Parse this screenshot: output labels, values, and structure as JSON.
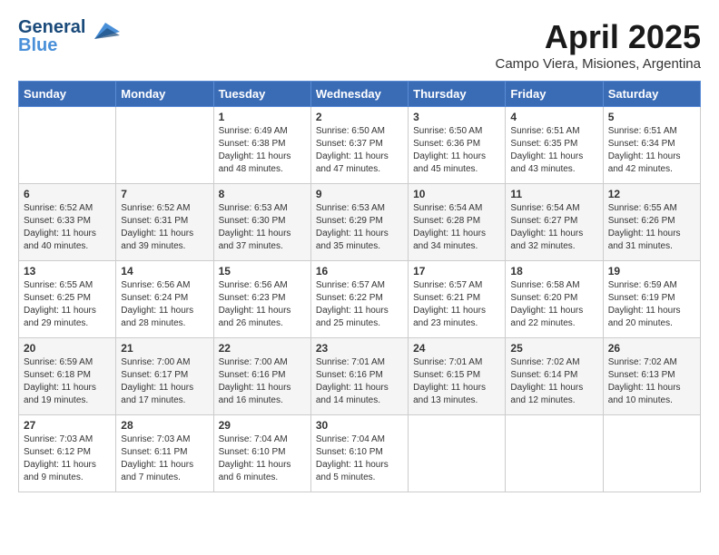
{
  "header": {
    "logo_line1": "General",
    "logo_line2": "Blue",
    "month_year": "April 2025",
    "location": "Campo Viera, Misiones, Argentina"
  },
  "weekdays": [
    "Sunday",
    "Monday",
    "Tuesday",
    "Wednesday",
    "Thursday",
    "Friday",
    "Saturday"
  ],
  "weeks": [
    [
      {
        "day": "",
        "info": ""
      },
      {
        "day": "",
        "info": ""
      },
      {
        "day": "1",
        "info": "Sunrise: 6:49 AM\nSunset: 6:38 PM\nDaylight: 11 hours and 48 minutes."
      },
      {
        "day": "2",
        "info": "Sunrise: 6:50 AM\nSunset: 6:37 PM\nDaylight: 11 hours and 47 minutes."
      },
      {
        "day": "3",
        "info": "Sunrise: 6:50 AM\nSunset: 6:36 PM\nDaylight: 11 hours and 45 minutes."
      },
      {
        "day": "4",
        "info": "Sunrise: 6:51 AM\nSunset: 6:35 PM\nDaylight: 11 hours and 43 minutes."
      },
      {
        "day": "5",
        "info": "Sunrise: 6:51 AM\nSunset: 6:34 PM\nDaylight: 11 hours and 42 minutes."
      }
    ],
    [
      {
        "day": "6",
        "info": "Sunrise: 6:52 AM\nSunset: 6:33 PM\nDaylight: 11 hours and 40 minutes."
      },
      {
        "day": "7",
        "info": "Sunrise: 6:52 AM\nSunset: 6:31 PM\nDaylight: 11 hours and 39 minutes."
      },
      {
        "day": "8",
        "info": "Sunrise: 6:53 AM\nSunset: 6:30 PM\nDaylight: 11 hours and 37 minutes."
      },
      {
        "day": "9",
        "info": "Sunrise: 6:53 AM\nSunset: 6:29 PM\nDaylight: 11 hours and 35 minutes."
      },
      {
        "day": "10",
        "info": "Sunrise: 6:54 AM\nSunset: 6:28 PM\nDaylight: 11 hours and 34 minutes."
      },
      {
        "day": "11",
        "info": "Sunrise: 6:54 AM\nSunset: 6:27 PM\nDaylight: 11 hours and 32 minutes."
      },
      {
        "day": "12",
        "info": "Sunrise: 6:55 AM\nSunset: 6:26 PM\nDaylight: 11 hours and 31 minutes."
      }
    ],
    [
      {
        "day": "13",
        "info": "Sunrise: 6:55 AM\nSunset: 6:25 PM\nDaylight: 11 hours and 29 minutes."
      },
      {
        "day": "14",
        "info": "Sunrise: 6:56 AM\nSunset: 6:24 PM\nDaylight: 11 hours and 28 minutes."
      },
      {
        "day": "15",
        "info": "Sunrise: 6:56 AM\nSunset: 6:23 PM\nDaylight: 11 hours and 26 minutes."
      },
      {
        "day": "16",
        "info": "Sunrise: 6:57 AM\nSunset: 6:22 PM\nDaylight: 11 hours and 25 minutes."
      },
      {
        "day": "17",
        "info": "Sunrise: 6:57 AM\nSunset: 6:21 PM\nDaylight: 11 hours and 23 minutes."
      },
      {
        "day": "18",
        "info": "Sunrise: 6:58 AM\nSunset: 6:20 PM\nDaylight: 11 hours and 22 minutes."
      },
      {
        "day": "19",
        "info": "Sunrise: 6:59 AM\nSunset: 6:19 PM\nDaylight: 11 hours and 20 minutes."
      }
    ],
    [
      {
        "day": "20",
        "info": "Sunrise: 6:59 AM\nSunset: 6:18 PM\nDaylight: 11 hours and 19 minutes."
      },
      {
        "day": "21",
        "info": "Sunrise: 7:00 AM\nSunset: 6:17 PM\nDaylight: 11 hours and 17 minutes."
      },
      {
        "day": "22",
        "info": "Sunrise: 7:00 AM\nSunset: 6:16 PM\nDaylight: 11 hours and 16 minutes."
      },
      {
        "day": "23",
        "info": "Sunrise: 7:01 AM\nSunset: 6:16 PM\nDaylight: 11 hours and 14 minutes."
      },
      {
        "day": "24",
        "info": "Sunrise: 7:01 AM\nSunset: 6:15 PM\nDaylight: 11 hours and 13 minutes."
      },
      {
        "day": "25",
        "info": "Sunrise: 7:02 AM\nSunset: 6:14 PM\nDaylight: 11 hours and 12 minutes."
      },
      {
        "day": "26",
        "info": "Sunrise: 7:02 AM\nSunset: 6:13 PM\nDaylight: 11 hours and 10 minutes."
      }
    ],
    [
      {
        "day": "27",
        "info": "Sunrise: 7:03 AM\nSunset: 6:12 PM\nDaylight: 11 hours and 9 minutes."
      },
      {
        "day": "28",
        "info": "Sunrise: 7:03 AM\nSunset: 6:11 PM\nDaylight: 11 hours and 7 minutes."
      },
      {
        "day": "29",
        "info": "Sunrise: 7:04 AM\nSunset: 6:10 PM\nDaylight: 11 hours and 6 minutes."
      },
      {
        "day": "30",
        "info": "Sunrise: 7:04 AM\nSunset: 6:10 PM\nDaylight: 11 hours and 5 minutes."
      },
      {
        "day": "",
        "info": ""
      },
      {
        "day": "",
        "info": ""
      },
      {
        "day": "",
        "info": ""
      }
    ]
  ]
}
